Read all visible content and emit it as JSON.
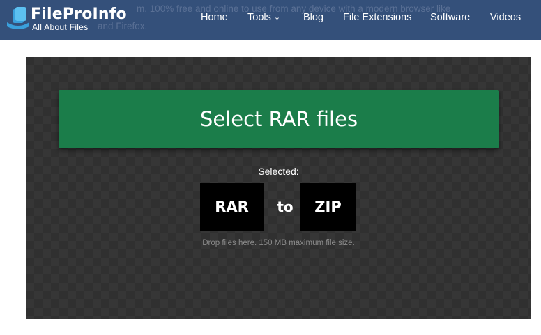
{
  "header": {
    "bg_text_line1": "m. 100% free and online to use from any device with a modern browser like",
    "bg_text_line2": "and Firefox.",
    "logo_title": "FileProInfo",
    "logo_subtitle": "All About Files",
    "nav": [
      {
        "label": "Home"
      },
      {
        "label": "Tools"
      },
      {
        "label": "Blog"
      },
      {
        "label": "File Extensions"
      },
      {
        "label": "Software"
      },
      {
        "label": "Videos"
      }
    ],
    "brand_color": "#34507a"
  },
  "converter": {
    "select_button_label": "Select RAR files",
    "selected_label": "Selected:",
    "from_format": "RAR",
    "to_word": "to",
    "to_format": "ZIP",
    "drop_hint": "Drop files here. 150 MB maximum file size.",
    "button_color": "#1b7d4a"
  }
}
